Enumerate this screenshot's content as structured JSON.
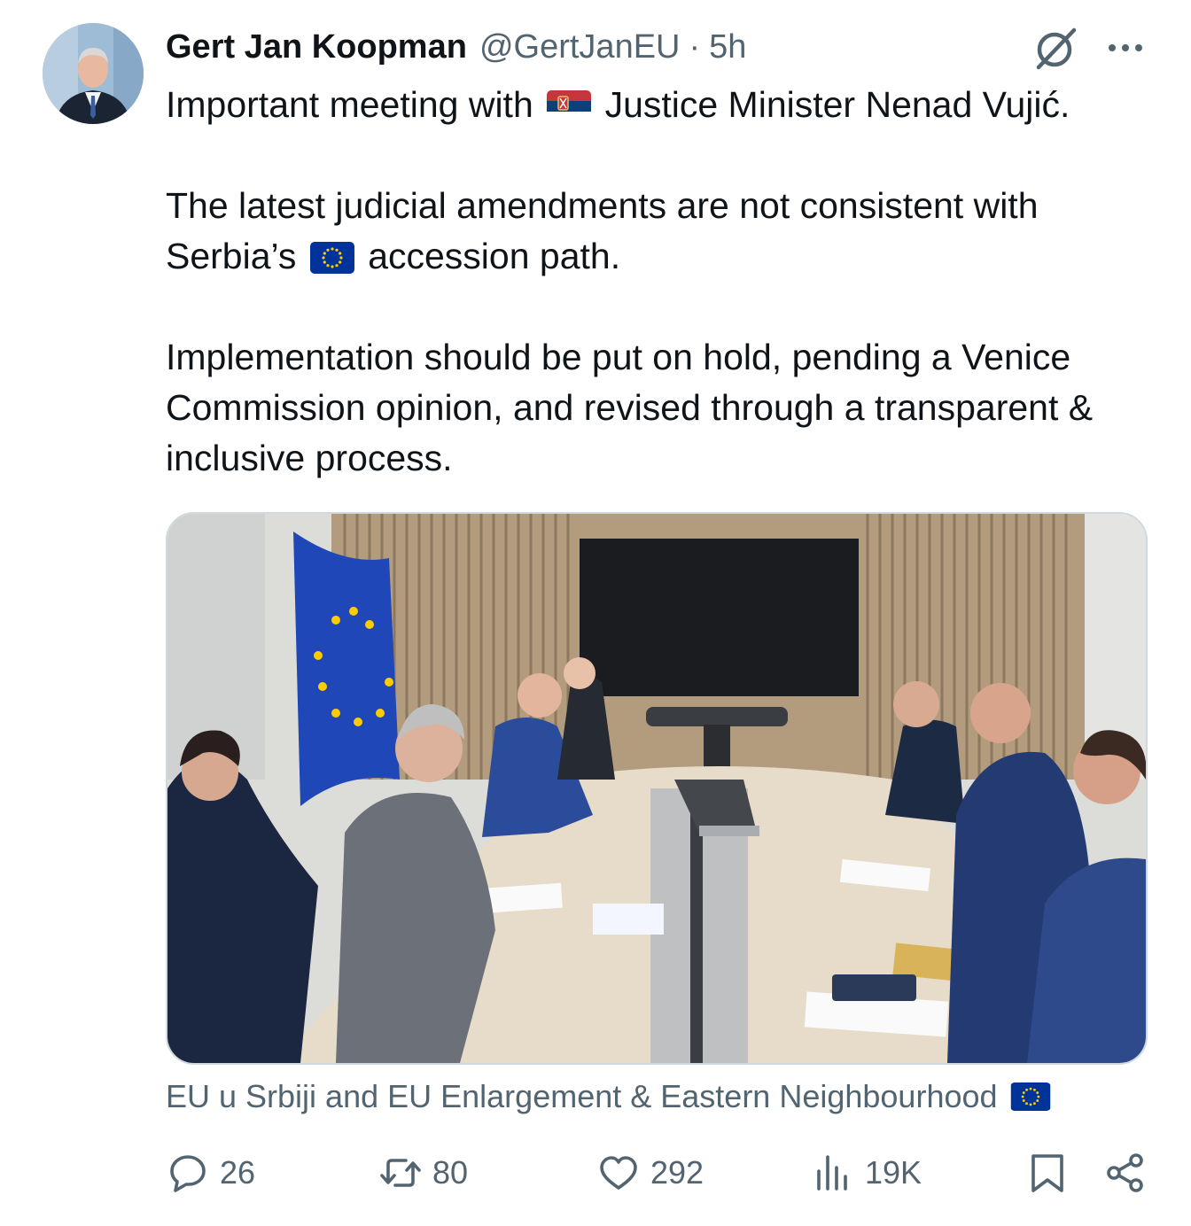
{
  "author": {
    "display_name": "Gert Jan Koopman",
    "handle": "@GertJanEU",
    "separator": "·",
    "time": "5h"
  },
  "tweet": {
    "line1_before": "Important meeting with",
    "line1_after": "Justice Minister Nenad Vujić.",
    "para2_before": "The latest judicial amendments are not consistent with Serbia’s",
    "para2_after": "accession path.",
    "para3": "Implementation should be put on hold, pending a Venice Commission opinion, and revised through a transparent & inclusive process."
  },
  "media": {
    "tagged": "EU u Srbiji and EU Enlargement & Eastern Neighbourhood"
  },
  "actions": {
    "replies": "26",
    "reposts": "80",
    "likes": "292",
    "views": "19K"
  },
  "icons": {
    "flag_serbia": "serbia-flag-icon",
    "flag_eu": "eu-flag-icon",
    "grok": "grok-icon",
    "more": "more-icon",
    "reply": "reply-icon",
    "repost": "repost-icon",
    "like": "heart-icon",
    "views": "views-icon",
    "bookmark": "bookmark-icon",
    "share": "share-icon"
  },
  "colors": {
    "text": "#0f1419",
    "secondary": "#536471",
    "border": "#cfd9de",
    "eu_blue": "#003399",
    "eu_yellow": "#ffcc00"
  }
}
